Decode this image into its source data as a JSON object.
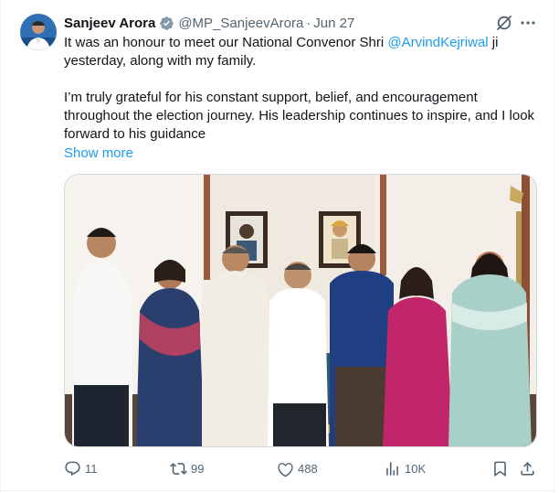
{
  "post": {
    "author_name": "Sanjeev Arora",
    "handle": "@MP_SanjeevArora",
    "separator": "·",
    "date": "Jun 27",
    "text_part1_pre": "It was an honour to meet our National Convenor Shri ",
    "mention": "@ArvindKejriwal",
    "text_part1_post": " ji yesterday, along with my family.",
    "text_part2": "I’m truly grateful for his constant support, belief, and encouragement throughout the election journey. His leadership continues to inspire, and I look forward to his guidance",
    "show_more": "Show more"
  },
  "icons": {
    "verified": "verified-badge-icon",
    "grok": "grok-icon",
    "more": "more-icon",
    "reply": "reply-icon",
    "repost": "repost-icon",
    "like": "like-icon",
    "views": "views-icon",
    "bookmark": "bookmark-icon",
    "share": "share-icon"
  },
  "colors": {
    "accent": "#1d9bf0",
    "text": "#0f1419",
    "secondary": "#536471",
    "border": "#cfd9de"
  },
  "actions": {
    "replies": "11",
    "reposts": "99",
    "likes": "488",
    "views": "10K"
  }
}
